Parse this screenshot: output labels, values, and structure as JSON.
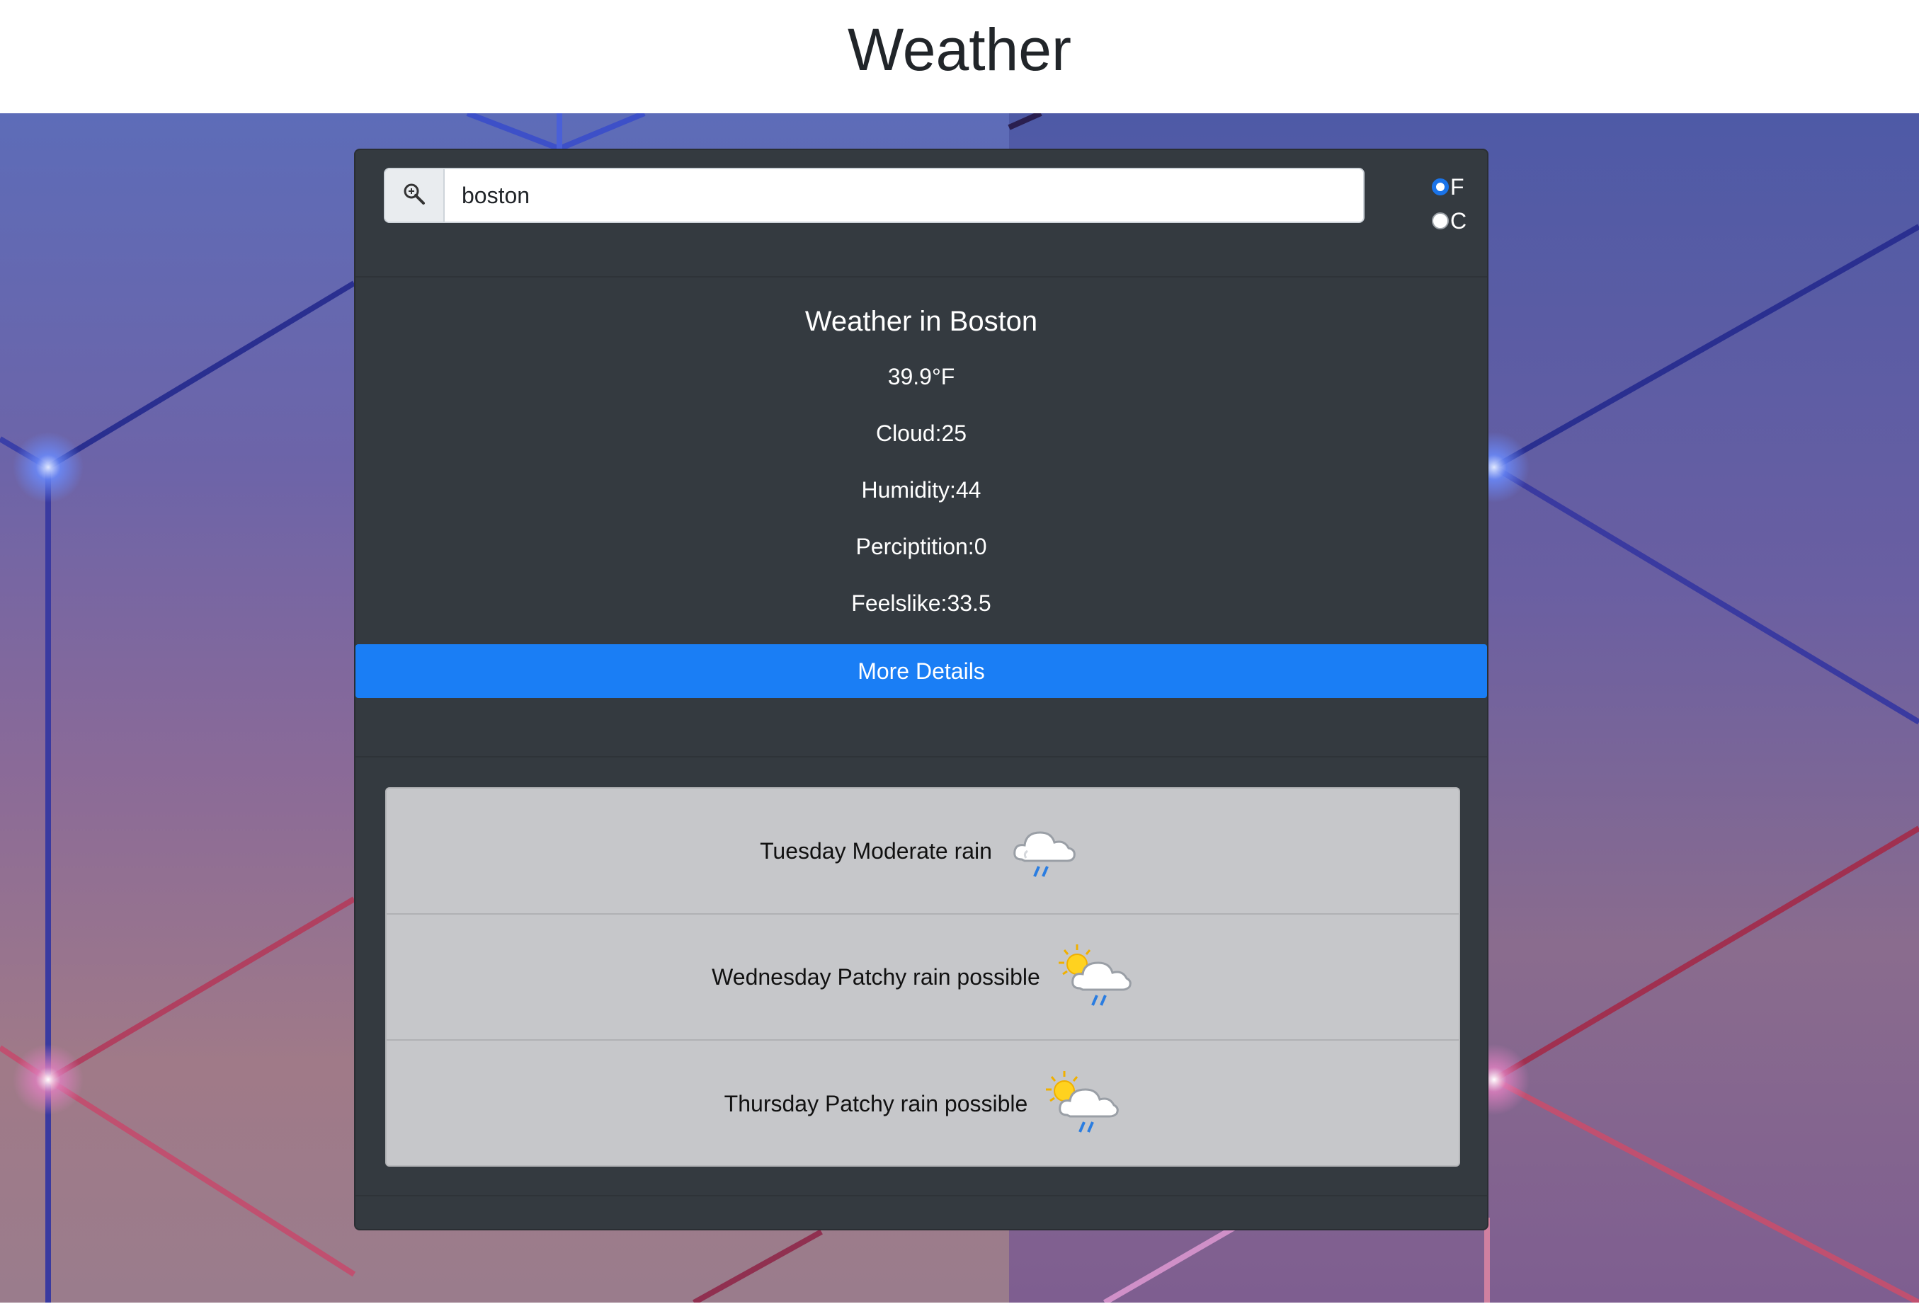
{
  "header": {
    "title": "Weather"
  },
  "search": {
    "value": "boston",
    "icon": "search-zoom-icon"
  },
  "units": {
    "options": [
      {
        "label": "F",
        "checked": true
      },
      {
        "label": "C",
        "checked": false
      }
    ],
    "accent": "#1a73e8"
  },
  "current": {
    "title": "Weather in Boston",
    "temperature": "39.9°F",
    "cloud": "Cloud:25",
    "humidity": "Humidity:44",
    "precipitation": "Perciptition:0",
    "feelslike": "Feelslike:33.5"
  },
  "details_button": {
    "label": "More Details",
    "color": "#1a7ef5"
  },
  "forecast": [
    {
      "text": "Tuesday Moderate rain",
      "icon": "rain-cloud-icon"
    },
    {
      "text": "Wednesday Patchy rain possible",
      "icon": "sun-rain-cloud-icon"
    },
    {
      "text": "Thursday Patchy rain possible",
      "icon": "sun-rain-cloud-icon"
    }
  ],
  "colors": {
    "card": "#343a40",
    "forecast_bg": "#c6c7ca"
  }
}
